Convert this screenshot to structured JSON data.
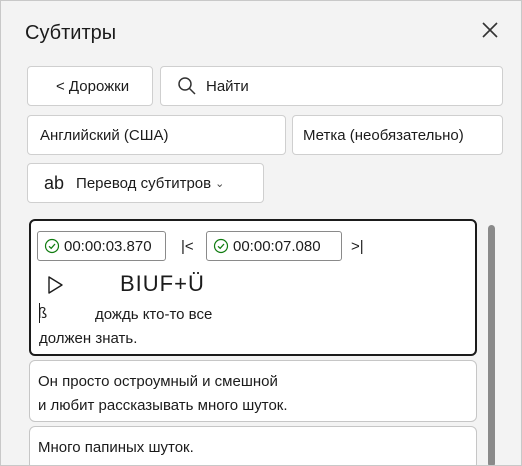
{
  "panel": {
    "title": "Субтитры"
  },
  "toolbar": {
    "tracks_label": "< Дорожки",
    "search_placeholder": "Найти",
    "language": "Английский (США)",
    "tag_label": "Метка (необязательно)",
    "translate_icon": "ab",
    "translate_label": "Перевод субтитров"
  },
  "active_caption": {
    "start": "00:00:03.870",
    "end": "00:00:07.080",
    "format_buttons": "BIUF+Ü",
    "cursor_glyph": "ß",
    "line1": "дождь кто-то все",
    "line2": "должен знать."
  },
  "captions": [
    {
      "lines": [
        "Он просто остроумный и смешной",
        "и любит рассказывать много шуток."
      ]
    },
    {
      "lines": [
        "Много папиных шуток."
      ]
    }
  ]
}
